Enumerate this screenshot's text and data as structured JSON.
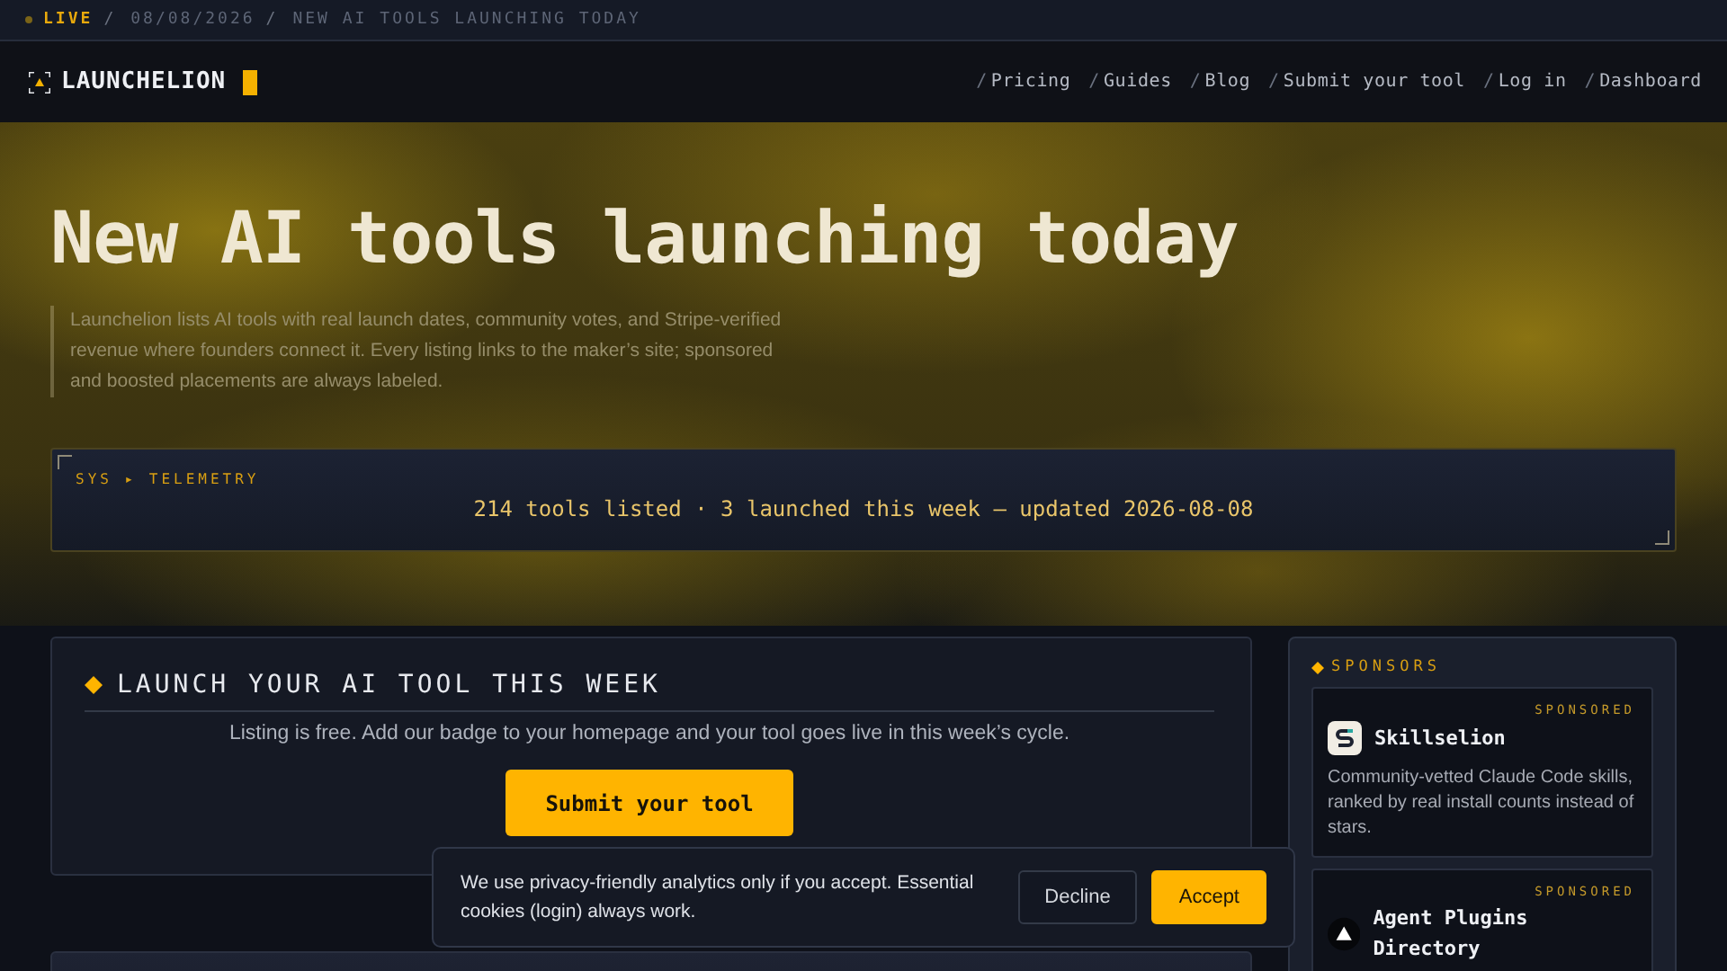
{
  "ticker": {
    "live": "LIVE",
    "separator": "/",
    "date": "08/08/2026",
    "headline": "NEW AI TOOLS LAUNCHING TODAY"
  },
  "brand": {
    "name": "LAUNCHELION"
  },
  "nav": [
    {
      "prefix": "/",
      "label": "Pricing"
    },
    {
      "prefix": "/",
      "label": "Guides"
    },
    {
      "prefix": "/",
      "label": "Blog"
    },
    {
      "prefix": "/",
      "label": "Submit your tool"
    },
    {
      "prefix": "/",
      "label": "Log in"
    },
    {
      "prefix": "/",
      "label": "Dashboard"
    }
  ],
  "hero": {
    "title": "New AI tools launching today",
    "intro": "Launchelion lists AI tools with real launch dates, community votes, and Stripe-verified revenue where founders connect it. Every listing links to the maker’s site; sponsored and boosted placements are always labeled."
  },
  "telemetry": {
    "label": "SYS ▸ TELEMETRY",
    "stats": "214 tools listed · 3 launched this week — updated 2026-08-08"
  },
  "launch_card": {
    "title": "LAUNCH YOUR AI TOOL THIS WEEK",
    "text": "Listing is free. Add our badge to your homepage and your tool goes live in this week’s cycle.",
    "button": "Submit your tool"
  },
  "sponsors": {
    "title": "SPONSORS",
    "items": [
      {
        "badge": "SPONSORED",
        "name": "Skillselion",
        "kind": "square",
        "description": "Community-vetted Claude Code skills, ranked by real install counts instead of stars."
      },
      {
        "badge": "SPONSORED",
        "name": "Agent Plugins Directory",
        "kind": "circle"
      }
    ]
  },
  "cookie_banner": {
    "text": "We use privacy-friendly analytics only if you accept. Essential cookies (login) always work.",
    "buttons": [
      "Decline",
      "Accept"
    ]
  }
}
